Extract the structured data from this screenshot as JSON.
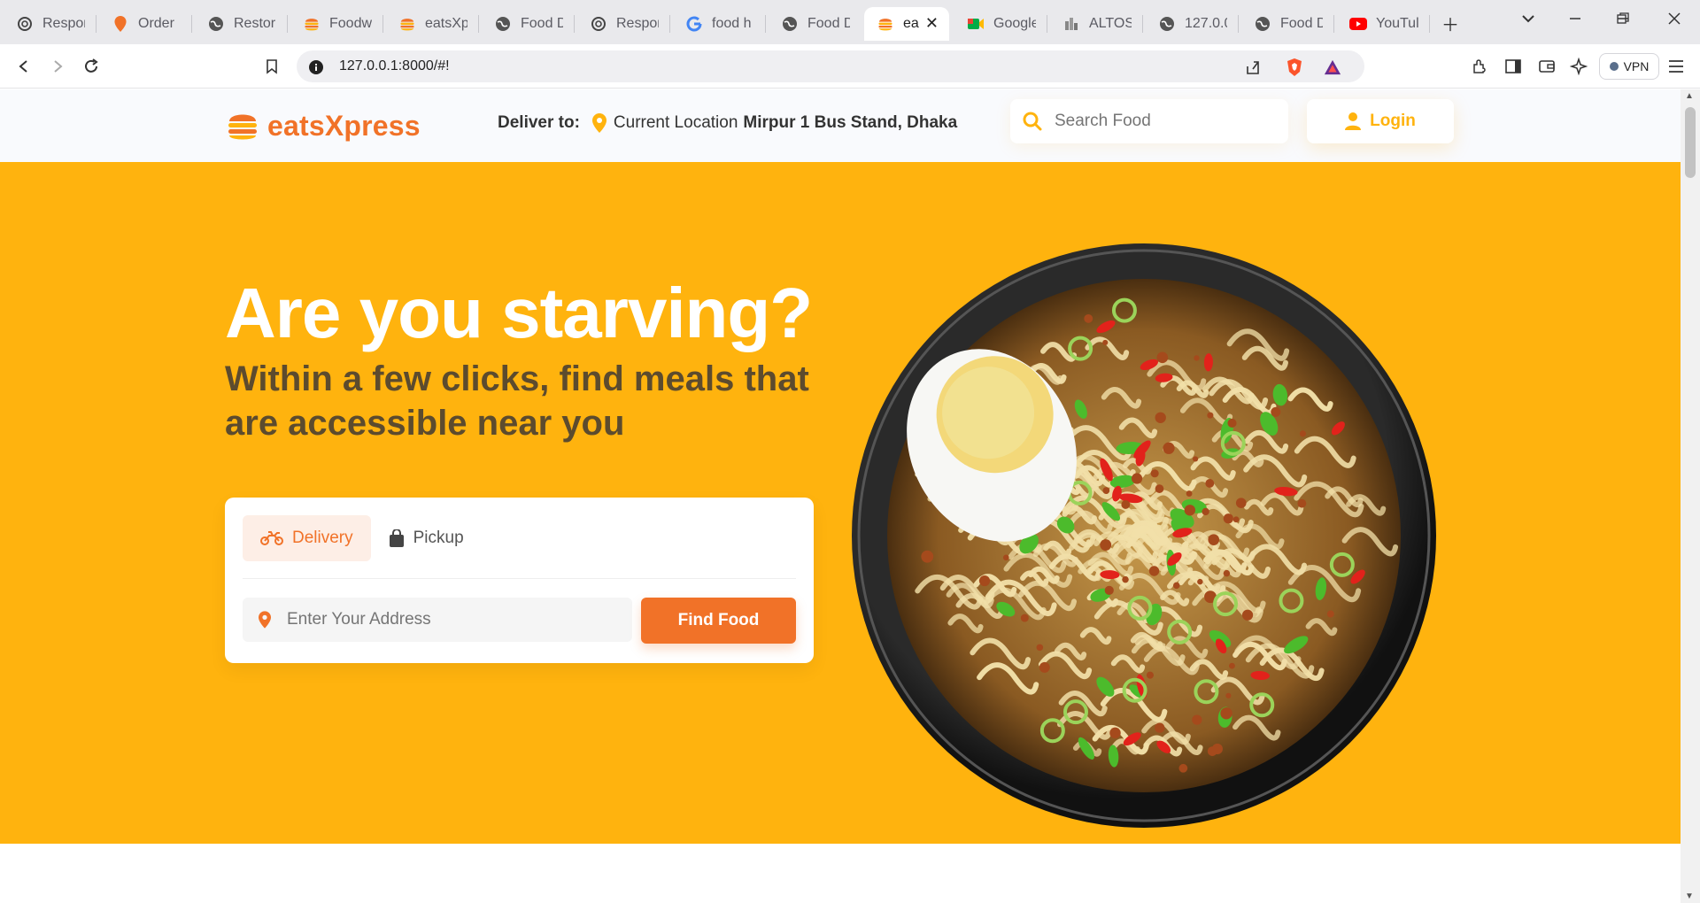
{
  "browser": {
    "tabs": [
      {
        "title": "Respon",
        "icon": "openai-icon"
      },
      {
        "title": "Order",
        "icon": "pin-icon"
      },
      {
        "title": "Restor",
        "icon": "globe-icon"
      },
      {
        "title": "Foodw",
        "icon": "burger-icon"
      },
      {
        "title": "eatsXp",
        "icon": "burger-icon"
      },
      {
        "title": "Food D",
        "icon": "globe-icon"
      },
      {
        "title": "Respon",
        "icon": "openai-icon"
      },
      {
        "title": "food h",
        "icon": "google-icon"
      },
      {
        "title": "Food D",
        "icon": "globe-icon"
      },
      {
        "title": "ea",
        "icon": "burger-icon",
        "active": true
      },
      {
        "title": "Google",
        "icon": "meet-icon"
      },
      {
        "title": "ALTOS",
        "icon": "altos-icon"
      },
      {
        "title": "127.0.0",
        "icon": "globe-icon"
      },
      {
        "title": "Food D",
        "icon": "globe-icon"
      },
      {
        "title": "YouTul",
        "icon": "youtube-icon"
      }
    ],
    "url": "127.0.0.1:8000/#!",
    "vpn_label": "VPN"
  },
  "header": {
    "logo_text": "eatsXpress",
    "deliver_label": "Deliver to:",
    "location_prefix": "Current Location",
    "location_name": "Mirpur 1 Bus Stand, Dhaka",
    "search_placeholder": "Search Food",
    "login_label": "Login"
  },
  "hero": {
    "title": "Are you starving?",
    "subtitle": "Within a few clicks, find meals that are accessible near you",
    "tabs": [
      {
        "label": "Delivery",
        "active": true
      },
      {
        "label": "Pickup",
        "active": false
      }
    ],
    "address_placeholder": "Enter Your Address",
    "find_button": "Find Food"
  },
  "colors": {
    "accent_orange": "#f17228",
    "hero_yellow": "#ffb30e",
    "subtitle_brown": "#5c4b2e"
  }
}
